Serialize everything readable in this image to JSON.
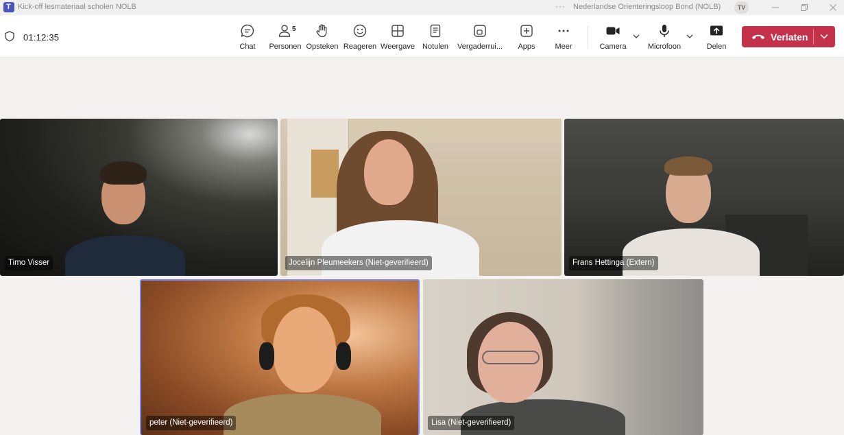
{
  "titlebar": {
    "window_title": "Kick-off lesmateriaal scholen NOLB",
    "more": "···",
    "organization": "Nederlandse Orienteringsloop Bond (NOLB)",
    "user_initials": "TV"
  },
  "call": {
    "timer": "01:12:35"
  },
  "toolbar": {
    "chat": "Chat",
    "people": "Personen",
    "people_count": "5",
    "raise": "Opsteken",
    "react": "Reageren",
    "view": "Weergave",
    "notes": "Notulen",
    "rooms": "Vergaderrui...",
    "apps": "Apps",
    "more": "Meer",
    "camera": "Camera",
    "mic": "Microfoon",
    "share": "Delen",
    "leave": "Verlaten"
  },
  "participants": [
    {
      "name": "Timo Visser"
    },
    {
      "name": "Jocelijn Pleumeekers (Niet-geverifieerd)"
    },
    {
      "name": "Frans Hettinga (Extern)"
    },
    {
      "name": "peter (Niet-geverifieerd)"
    },
    {
      "name": "Lisa (Niet-geverifieerd)"
    }
  ],
  "colors": {
    "accent": "#4b53bc",
    "leave_button": "#c4314b",
    "active_speaker_border": "#7f85f5"
  },
  "icons": {
    "shield": "shield-icon",
    "chat": "chat-icon",
    "people": "people-icon",
    "raise": "hand-icon",
    "react": "smiley-icon",
    "view": "grid-icon",
    "notes": "notes-icon",
    "rooms": "breakout-rooms-icon",
    "apps": "plus-square-icon",
    "more": "more-icon",
    "camera": "camera-icon",
    "mic": "microphone-icon",
    "share": "share-icon",
    "leave": "hangup-icon"
  }
}
